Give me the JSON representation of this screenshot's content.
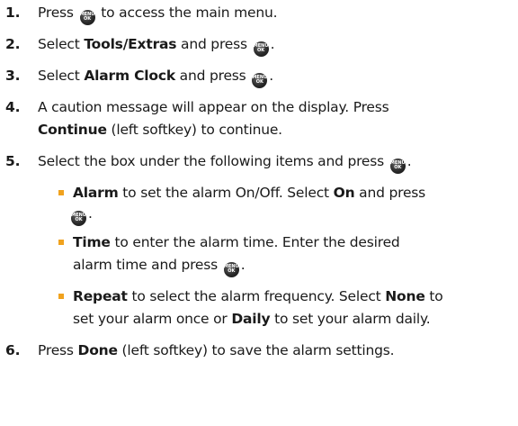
{
  "icon": {
    "name": "menu-ok-icon",
    "top": "MENU",
    "bottom": "OK"
  },
  "steps": [
    {
      "num": "1.",
      "a": "Press ",
      "b": " to access the main menu."
    },
    {
      "num": "2.",
      "a": "Select ",
      "bold": "Tools/Extras",
      "b": " and press ",
      "c": "."
    },
    {
      "num": "3.",
      "a": "Select ",
      "bold": "Alarm Clock",
      "b": " and press ",
      "c": "."
    },
    {
      "num": "4.",
      "line1": "A caution message will appear on the display. Press",
      "bold": "Continue",
      "b": " (left softkey) to continue."
    },
    {
      "num": "5.",
      "a": "Select the box under the following items and press ",
      "c": "."
    },
    {
      "num": "6.",
      "a": "Press ",
      "bold": "Done",
      "b": " (left softkey) to save the alarm settings."
    }
  ],
  "sub_items": [
    {
      "bold": "Alarm",
      "a": " to set the alarm On/Off. Select ",
      "bold2": "On",
      "b": " and press",
      "c": "."
    },
    {
      "bold": "Time",
      "a": " to enter the alarm time. Enter the desired",
      "line2": "alarm time and press ",
      "c": "."
    },
    {
      "bold": "Repeat",
      "a": " to select the alarm frequency. Select ",
      "bold2": "None",
      "b": " to",
      "line2a": "set your alarm once or ",
      "bold3": "Daily",
      "line2b": " to set your alarm daily."
    }
  ]
}
